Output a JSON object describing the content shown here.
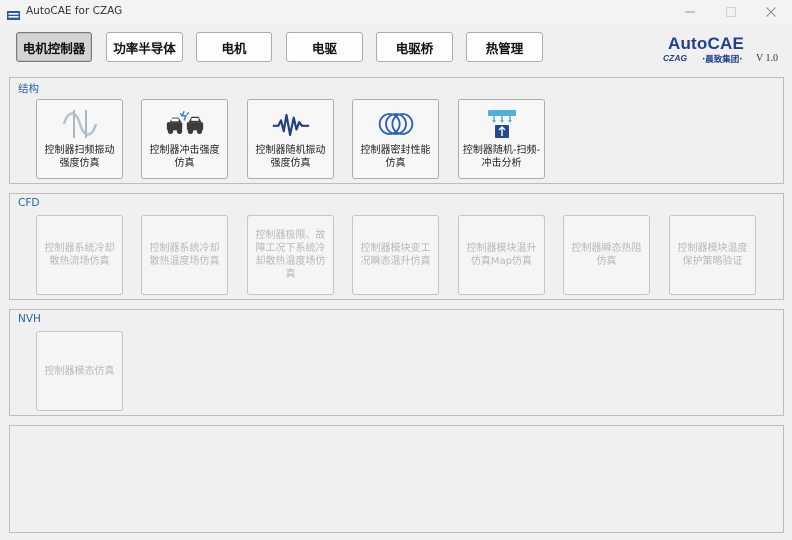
{
  "window": {
    "title": "AutoCAE for CZAG",
    "icon": "app-icon",
    "controls": [
      "minimize-icon",
      "maximize-icon",
      "close-icon"
    ]
  },
  "tabs": [
    {
      "label": "电机控制器",
      "active": true
    },
    {
      "label": "功率半导体",
      "active": false
    },
    {
      "label": "电机",
      "active": false
    },
    {
      "label": "电驱",
      "active": false
    },
    {
      "label": "电驱桥",
      "active": false
    },
    {
      "label": "热管理",
      "active": false
    }
  ],
  "logo": {
    "main": "AutoCAE",
    "sub": "CZAG",
    "sub2": "·晨致集团·",
    "version": "V 1.0",
    "brand_color": "#1f3f8f"
  },
  "groups": {
    "structure": {
      "title": "结构",
      "cards": [
        {
          "label": "控制器扫频振动强度仿真",
          "icon": "sine-wave-icon",
          "enabled": true
        },
        {
          "label": "控制器冲击强度仿真",
          "icon": "car-crash-icon",
          "enabled": true
        },
        {
          "label": "控制器随机振动强度仿真",
          "icon": "random-vibration-icon",
          "enabled": true
        },
        {
          "label": "控制器密封性能仿真",
          "icon": "seal-rings-icon",
          "enabled": true
        },
        {
          "label": "控制器随机-扫频-冲击分析",
          "icon": "combined-analysis-icon",
          "enabled": true
        }
      ]
    },
    "cfd": {
      "title": "CFD",
      "cards": [
        {
          "label": "控制器系统冷却散热流场仿真",
          "enabled": false
        },
        {
          "label": "控制器系统冷却散热温度场仿真",
          "enabled": false
        },
        {
          "label": "控制器极限、故障工况下系统冷却散热温度场仿真",
          "enabled": false
        },
        {
          "label": "控制器模块变工况瞬态温升仿真",
          "enabled": false
        },
        {
          "label": "控制器模块温升仿真Map仿真",
          "enabled": false
        },
        {
          "label": "控制器瞬态热阻仿真",
          "enabled": false
        },
        {
          "label": "控制器模块温度保护策略验证",
          "enabled": false
        }
      ]
    },
    "nvh": {
      "title": "NVH",
      "cards": [
        {
          "label": "控制器模态仿真",
          "enabled": false
        }
      ]
    }
  }
}
